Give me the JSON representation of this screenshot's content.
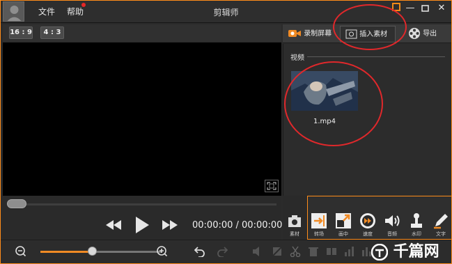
{
  "menu": {
    "file": "文件",
    "help": "帮助"
  },
  "app_title": "剪辑师",
  "aspect": {
    "wide": "16 : 9",
    "standard": "4 : 3"
  },
  "time": "00:00:00 / 00:00:00",
  "tabs": [
    {
      "label": "录制屏幕",
      "icon": "camera-icon"
    },
    {
      "label": "插入素材",
      "icon": "insert-media-icon"
    },
    {
      "label": "导出",
      "icon": "film-reel-icon"
    }
  ],
  "media": {
    "section": "视频",
    "item": "1.mp4"
  },
  "tools": [
    {
      "label": "素材",
      "icon": "material-camera-icon"
    },
    {
      "label": "转场",
      "icon": "transition-icon"
    },
    {
      "label": "画中",
      "icon": "picture-in-picture-icon"
    },
    {
      "label": "速度",
      "icon": "speed-icon"
    },
    {
      "label": "音频",
      "icon": "audio-icon"
    },
    {
      "label": "水印",
      "icon": "watermark-icon"
    },
    {
      "label": "文字",
      "icon": "text-pen-icon"
    }
  ],
  "zoom": {
    "level": 0.43
  },
  "watermark": "千篇网",
  "colors": {
    "accent": "#ff8c1a",
    "annotation": "#e0282b"
  }
}
